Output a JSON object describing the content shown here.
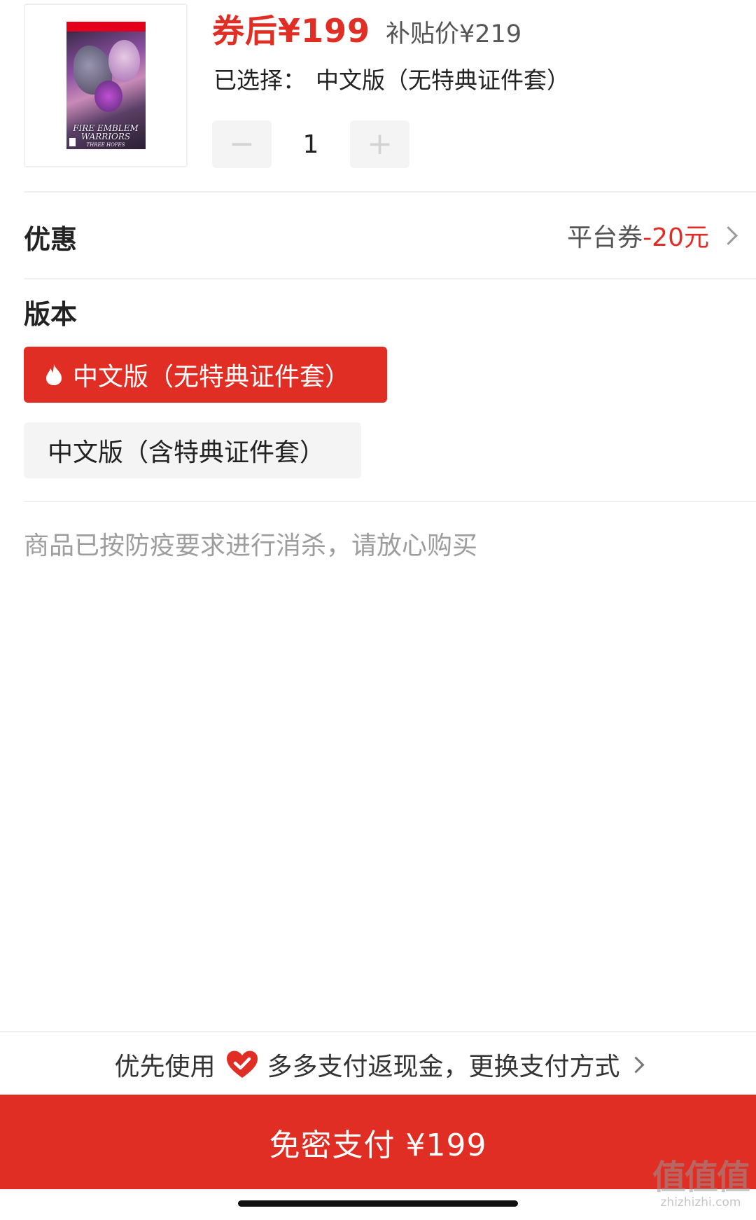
{
  "product": {
    "cover_title": "FIRE EMBLEM WARRIORS",
    "cover_subtitle": "THREE HOPES",
    "price_main": "券后¥199",
    "price_sub": "补贴价¥219",
    "selected_prefix": "已选择：",
    "selected_value": "中文版（无特典证件套）",
    "quantity": "1",
    "minus_symbol": "−",
    "plus_symbol": "+"
  },
  "discount": {
    "label": "优惠",
    "coupon_label": "平台券",
    "coupon_value": "-20元"
  },
  "version": {
    "label": "版本",
    "options": [
      {
        "label": "中文版（无特典证件套）",
        "selected": true
      },
      {
        "label": "中文版（含特典证件套）",
        "selected": false
      }
    ]
  },
  "notice": "商品已按防疫要求进行消杀，请放心购买",
  "payment": {
    "hint_prefix": "优先使用",
    "hint_suffix": "多多支付返现金，更换支付方式",
    "button_label": "免密支付 ¥199"
  },
  "watermark": {
    "main": "值值值",
    "sub": "zhizhizhi.com"
  },
  "colors": {
    "accent": "#e02e24",
    "muted_text": "#9d9d9d",
    "option_bg": "#f4f4f4"
  }
}
